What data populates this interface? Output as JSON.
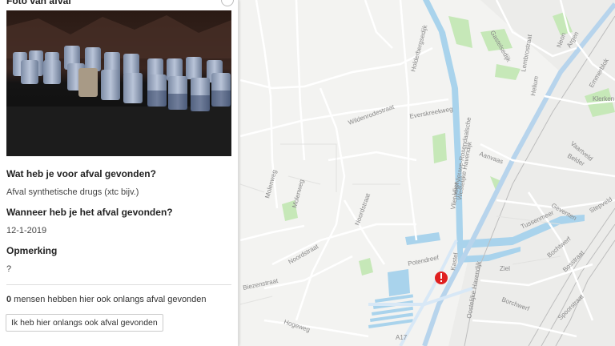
{
  "panel": {
    "title": "Foto van afval",
    "photo_alt": "jerrycans",
    "q1": "Wat heb je voor afval gevonden?",
    "a1": "Afval synthetische drugs (xtc bijv.)",
    "q2": "Wanneer heb je het afval gevonden?",
    "a2": "12-1-2019",
    "q3": "Opmerking",
    "a3": "?",
    "count": "0",
    "count_text": " mensen hebben hier ook onlangs afval gevonden",
    "button": "Ik heb hier onlangs ook afval gevonden"
  },
  "map": {
    "labels": {
      "molenweg1": "Molenweg",
      "molenweg2": "Molenweg",
      "wildenrode": "Wildenrodestraat",
      "everskreek": "Everskreekweg",
      "holderberg": "Holderbergsedijk",
      "vlietweg": "Vlietweg/Nieuwe-Rosendaalsche",
      "westelijke": "Westelijke Havendijk",
      "vliet": "Vliet",
      "noordstraat1": "Noordstraat",
      "noordstraat2": "Noordstraat",
      "biezen": "Biezenstraat",
      "hogeweg": "Hogeweg",
      "potendreef": "Potendreef",
      "kastel": "Kastel",
      "oostelijke": "Oostelijke Havendijk",
      "aanvaas": "Aanvaas",
      "belder": "Belder",
      "vaartveld": "Vaartveld",
      "geventen": "Geventen",
      "tussenmeer": "Tussenmeer",
      "bochtwerf": "Bochtwerf",
      "bosstraat": "Bosstraat",
      "ziel": "Ziel",
      "borchwerf": "Borchwerf",
      "speorstraat": "Spoorstraat",
      "stepveld": "Stepveld",
      "klerken": "Klerken",
      "emmerblok": "Emmerblok",
      "argen": "Argen",
      "helium": "Helium",
      "neon": "Neon",
      "lembrostraat": "Lembrostraat",
      "gastelsedijk": "Gastelsedijk",
      "a17": "A17"
    },
    "marker_icon": "exclamation-marker-icon",
    "marker_color": "#e02020",
    "water_color": "#a9d3ec",
    "green_color": "#c6e8b8"
  }
}
